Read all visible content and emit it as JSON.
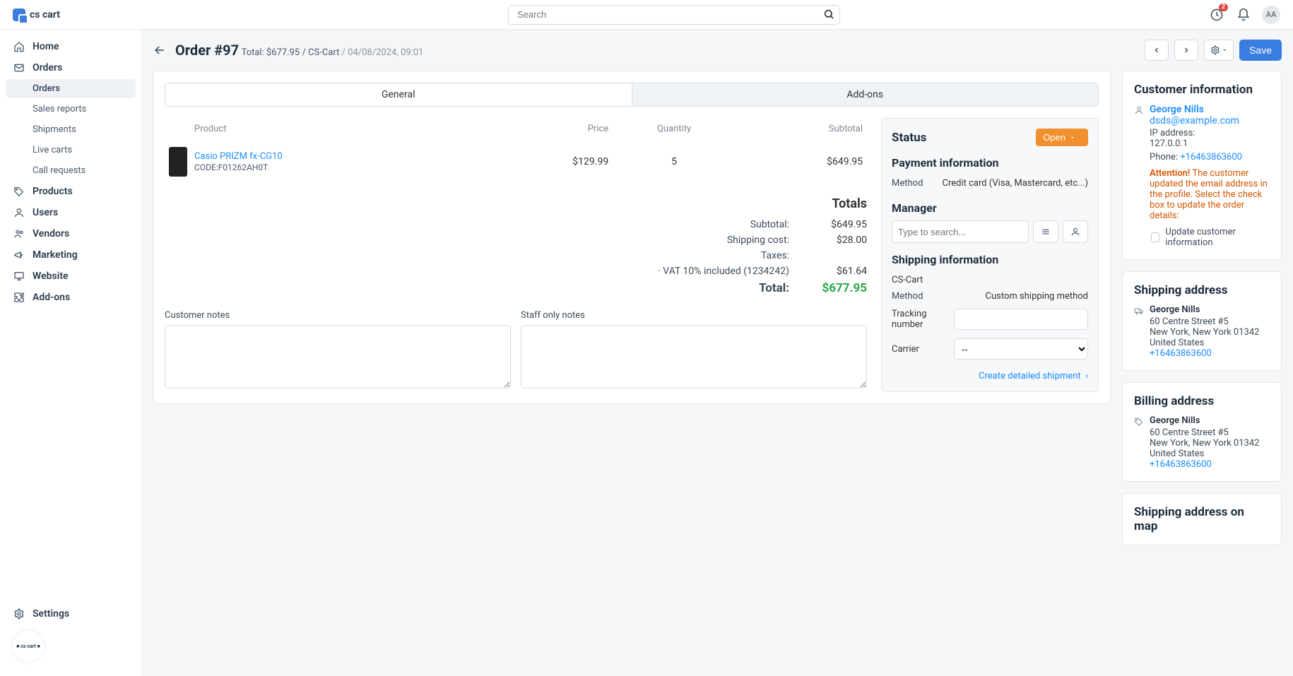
{
  "logo_text": "cs cart",
  "search_placeholder": "Search",
  "notif_count": "2",
  "avatar_initials": "AA",
  "sidebar": {
    "items": [
      {
        "label": "Home"
      },
      {
        "label": "Orders"
      },
      {
        "label": "Products"
      },
      {
        "label": "Users"
      },
      {
        "label": "Vendors"
      },
      {
        "label": "Marketing"
      },
      {
        "label": "Website"
      },
      {
        "label": "Add-ons"
      }
    ],
    "orders_sub": [
      {
        "label": "Orders"
      },
      {
        "label": "Sales reports"
      },
      {
        "label": "Shipments"
      },
      {
        "label": "Live carts"
      },
      {
        "label": "Call requests"
      }
    ],
    "settings_label": "Settings"
  },
  "header": {
    "title": "Order #97",
    "total_label": "Total: $677.95 / CS-Cart",
    "date": "/ 04/08/2024, 09:01",
    "save_label": "Save"
  },
  "tabs": {
    "general": "General",
    "addons": "Add-ons"
  },
  "product_table": {
    "cols": {
      "product": "Product",
      "price": "Price",
      "qty": "Quantity",
      "subtotal": "Subtotal"
    },
    "rows": [
      {
        "name": "Casio PRIZM fx-CG10",
        "code_label": "CODE:",
        "code": "F01262AH0T",
        "price": "$129.99",
        "qty": "5",
        "subtotal": "$649.95"
      }
    ]
  },
  "totals": {
    "heading": "Totals",
    "subtotal_label": "Subtotal:",
    "subtotal": "$649.95",
    "ship_label": "Shipping cost:",
    "ship": "$28.00",
    "taxes_label": "Taxes:",
    "vat_label": "· VAT 10% included (1234242)",
    "vat": "$61.64",
    "total_label": "Total:",
    "total": "$677.95"
  },
  "notes": {
    "cust_label": "Customer notes",
    "staff_label": "Staff only notes"
  },
  "status_panel": {
    "status_heading": "Status",
    "status_value": "Open",
    "pay_heading": "Payment information",
    "pay_method_label": "Method",
    "pay_method_value": "Credit card (Visa, Mastercard, etc...)",
    "manager_heading": "Manager",
    "manager_placeholder": "Type to search...",
    "ship_heading": "Shipping information",
    "ship_vendor": "CS-Cart",
    "ship_method_label": "Method",
    "ship_method_value": "Custom shipping method",
    "track_label": "Tracking number",
    "carrier_label": "Carrier",
    "carrier_value": "--",
    "create_link": "Create detailed shipment"
  },
  "customer": {
    "heading": "Customer information",
    "name": "George Nills",
    "email": "dsds@example.com",
    "ip_label": "IP address:",
    "ip": "127.0.0.1",
    "phone_label": "Phone: ",
    "phone": "+16463863600",
    "attention_label": "Attention!",
    "attention_text": " The customer updated the email address in the profile. Select the check box to update the order details:",
    "update_checkbox": "Update customer information"
  },
  "shipping_addr": {
    "heading": "Shipping address",
    "name": "George Nills",
    "street": "60 Centre Street #5",
    "city": "New York, New York 01342",
    "country": "United States",
    "phone": "+16463863600"
  },
  "billing_addr": {
    "heading": "Billing address",
    "name": "George Nills",
    "street": "60 Centre Street #5",
    "city": "New York, New York 01342",
    "country": "United States",
    "phone": "+16463863600"
  },
  "map_heading": "Shipping address on map"
}
